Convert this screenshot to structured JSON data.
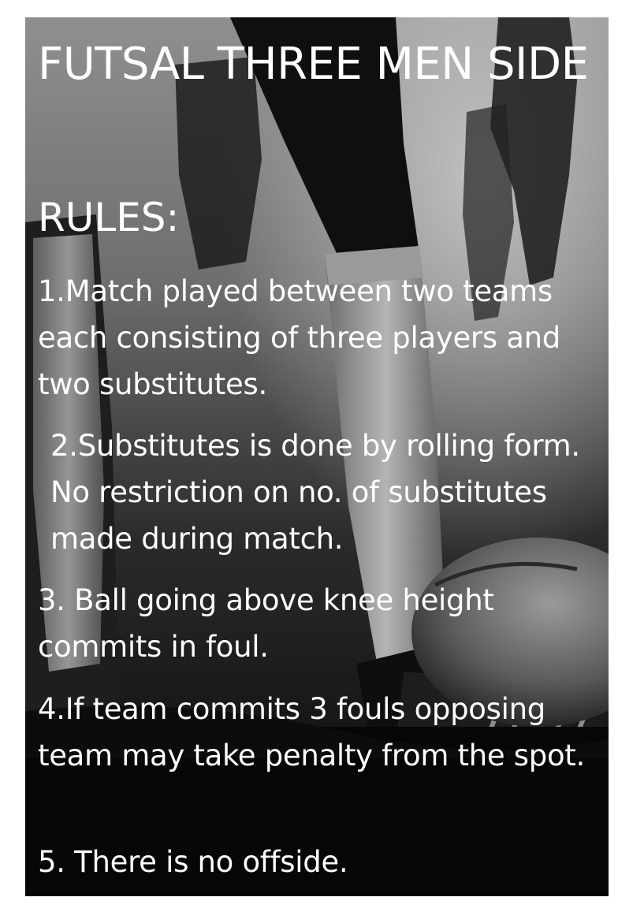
{
  "poster": {
    "title": "FUTSAL THREE MEN SIDE",
    "rules_heading": "RULES:",
    "rules": [
      "1.Match played between two teams each consisting of three players and two substitutes.",
      "2.Substitutes is done by rolling form. No restriction on no. of substitutes made during match.",
      "3. Ball going above knee height commits in foul.",
      "4.If team commits 3 fouls opposing team may take penalty from the spot.",
      "5. There is no offside."
    ],
    "background_photo": "soccer-players-legs-and-ball-grayscale",
    "colors": {
      "text": "#ffffff",
      "background": "#0b0b0b"
    }
  }
}
